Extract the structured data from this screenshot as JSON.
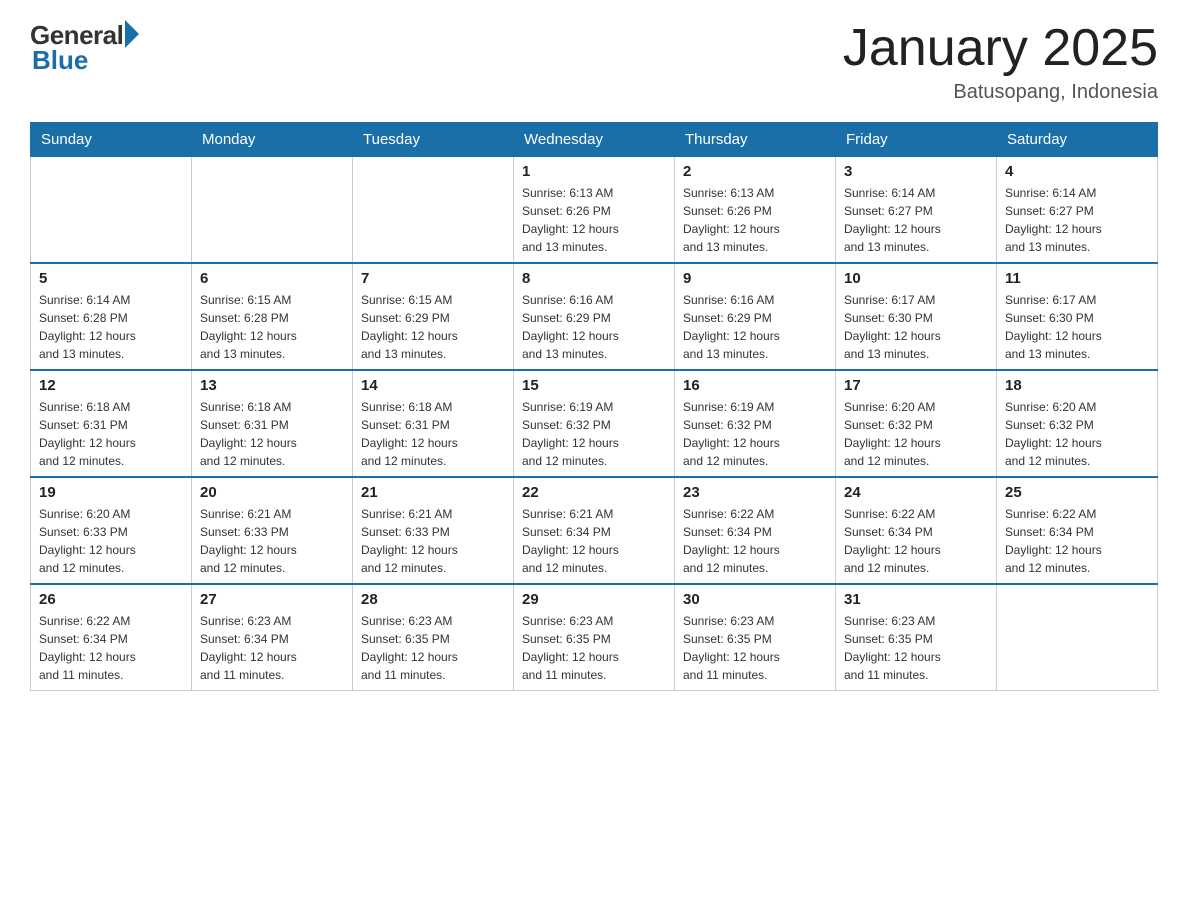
{
  "header": {
    "logo_general": "General",
    "logo_blue": "Blue",
    "month_title": "January 2025",
    "location": "Batusopang, Indonesia"
  },
  "weekdays": [
    "Sunday",
    "Monday",
    "Tuesday",
    "Wednesday",
    "Thursday",
    "Friday",
    "Saturday"
  ],
  "weeks": [
    [
      {
        "day": "",
        "info": ""
      },
      {
        "day": "",
        "info": ""
      },
      {
        "day": "",
        "info": ""
      },
      {
        "day": "1",
        "info": "Sunrise: 6:13 AM\nSunset: 6:26 PM\nDaylight: 12 hours\nand 13 minutes."
      },
      {
        "day": "2",
        "info": "Sunrise: 6:13 AM\nSunset: 6:26 PM\nDaylight: 12 hours\nand 13 minutes."
      },
      {
        "day": "3",
        "info": "Sunrise: 6:14 AM\nSunset: 6:27 PM\nDaylight: 12 hours\nand 13 minutes."
      },
      {
        "day": "4",
        "info": "Sunrise: 6:14 AM\nSunset: 6:27 PM\nDaylight: 12 hours\nand 13 minutes."
      }
    ],
    [
      {
        "day": "5",
        "info": "Sunrise: 6:14 AM\nSunset: 6:28 PM\nDaylight: 12 hours\nand 13 minutes."
      },
      {
        "day": "6",
        "info": "Sunrise: 6:15 AM\nSunset: 6:28 PM\nDaylight: 12 hours\nand 13 minutes."
      },
      {
        "day": "7",
        "info": "Sunrise: 6:15 AM\nSunset: 6:29 PM\nDaylight: 12 hours\nand 13 minutes."
      },
      {
        "day": "8",
        "info": "Sunrise: 6:16 AM\nSunset: 6:29 PM\nDaylight: 12 hours\nand 13 minutes."
      },
      {
        "day": "9",
        "info": "Sunrise: 6:16 AM\nSunset: 6:29 PM\nDaylight: 12 hours\nand 13 minutes."
      },
      {
        "day": "10",
        "info": "Sunrise: 6:17 AM\nSunset: 6:30 PM\nDaylight: 12 hours\nand 13 minutes."
      },
      {
        "day": "11",
        "info": "Sunrise: 6:17 AM\nSunset: 6:30 PM\nDaylight: 12 hours\nand 13 minutes."
      }
    ],
    [
      {
        "day": "12",
        "info": "Sunrise: 6:18 AM\nSunset: 6:31 PM\nDaylight: 12 hours\nand 12 minutes."
      },
      {
        "day": "13",
        "info": "Sunrise: 6:18 AM\nSunset: 6:31 PM\nDaylight: 12 hours\nand 12 minutes."
      },
      {
        "day": "14",
        "info": "Sunrise: 6:18 AM\nSunset: 6:31 PM\nDaylight: 12 hours\nand 12 minutes."
      },
      {
        "day": "15",
        "info": "Sunrise: 6:19 AM\nSunset: 6:32 PM\nDaylight: 12 hours\nand 12 minutes."
      },
      {
        "day": "16",
        "info": "Sunrise: 6:19 AM\nSunset: 6:32 PM\nDaylight: 12 hours\nand 12 minutes."
      },
      {
        "day": "17",
        "info": "Sunrise: 6:20 AM\nSunset: 6:32 PM\nDaylight: 12 hours\nand 12 minutes."
      },
      {
        "day": "18",
        "info": "Sunrise: 6:20 AM\nSunset: 6:32 PM\nDaylight: 12 hours\nand 12 minutes."
      }
    ],
    [
      {
        "day": "19",
        "info": "Sunrise: 6:20 AM\nSunset: 6:33 PM\nDaylight: 12 hours\nand 12 minutes."
      },
      {
        "day": "20",
        "info": "Sunrise: 6:21 AM\nSunset: 6:33 PM\nDaylight: 12 hours\nand 12 minutes."
      },
      {
        "day": "21",
        "info": "Sunrise: 6:21 AM\nSunset: 6:33 PM\nDaylight: 12 hours\nand 12 minutes."
      },
      {
        "day": "22",
        "info": "Sunrise: 6:21 AM\nSunset: 6:34 PM\nDaylight: 12 hours\nand 12 minutes."
      },
      {
        "day": "23",
        "info": "Sunrise: 6:22 AM\nSunset: 6:34 PM\nDaylight: 12 hours\nand 12 minutes."
      },
      {
        "day": "24",
        "info": "Sunrise: 6:22 AM\nSunset: 6:34 PM\nDaylight: 12 hours\nand 12 minutes."
      },
      {
        "day": "25",
        "info": "Sunrise: 6:22 AM\nSunset: 6:34 PM\nDaylight: 12 hours\nand 12 minutes."
      }
    ],
    [
      {
        "day": "26",
        "info": "Sunrise: 6:22 AM\nSunset: 6:34 PM\nDaylight: 12 hours\nand 11 minutes."
      },
      {
        "day": "27",
        "info": "Sunrise: 6:23 AM\nSunset: 6:34 PM\nDaylight: 12 hours\nand 11 minutes."
      },
      {
        "day": "28",
        "info": "Sunrise: 6:23 AM\nSunset: 6:35 PM\nDaylight: 12 hours\nand 11 minutes."
      },
      {
        "day": "29",
        "info": "Sunrise: 6:23 AM\nSunset: 6:35 PM\nDaylight: 12 hours\nand 11 minutes."
      },
      {
        "day": "30",
        "info": "Sunrise: 6:23 AM\nSunset: 6:35 PM\nDaylight: 12 hours\nand 11 minutes."
      },
      {
        "day": "31",
        "info": "Sunrise: 6:23 AM\nSunset: 6:35 PM\nDaylight: 12 hours\nand 11 minutes."
      },
      {
        "day": "",
        "info": ""
      }
    ]
  ]
}
